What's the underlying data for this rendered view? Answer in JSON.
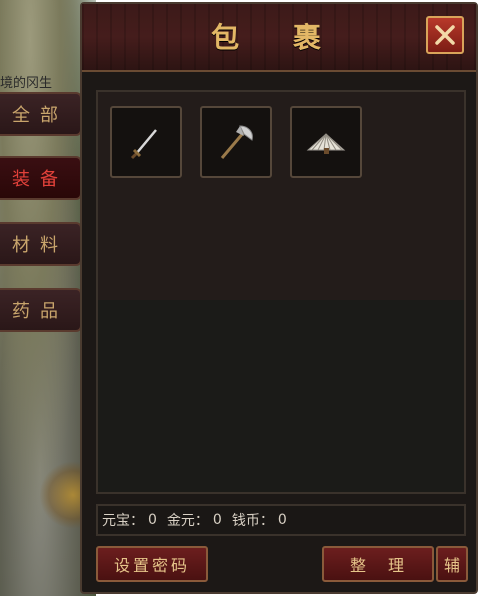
{
  "window": {
    "title": "包  裹",
    "close_icon": "close-icon"
  },
  "background": {
    "partial_text": "境的冈生"
  },
  "tabs": [
    {
      "label": "全部",
      "active": false
    },
    {
      "label": "装备",
      "active": true
    },
    {
      "label": "材料",
      "active": false
    },
    {
      "label": "药品",
      "active": false
    }
  ],
  "items": [
    {
      "icon": "sword-icon"
    },
    {
      "icon": "axe-icon"
    },
    {
      "icon": "fan-icon"
    }
  ],
  "currency": {
    "yuanbao_label": "元宝：",
    "yuanbao_value": "0",
    "jinyuan_label": "金元：",
    "jinyuan_value": "0",
    "qianbi_label": "钱币：",
    "qianbi_value": "0"
  },
  "buttons": {
    "set_password": "设置密码",
    "sort": "整理",
    "aux": "辅"
  },
  "colors": {
    "accent_gold": "#e3b766",
    "active_tab_text": "#e2413a",
    "panel_bg": "#1c1816",
    "button_red": "#6c1e1e"
  }
}
